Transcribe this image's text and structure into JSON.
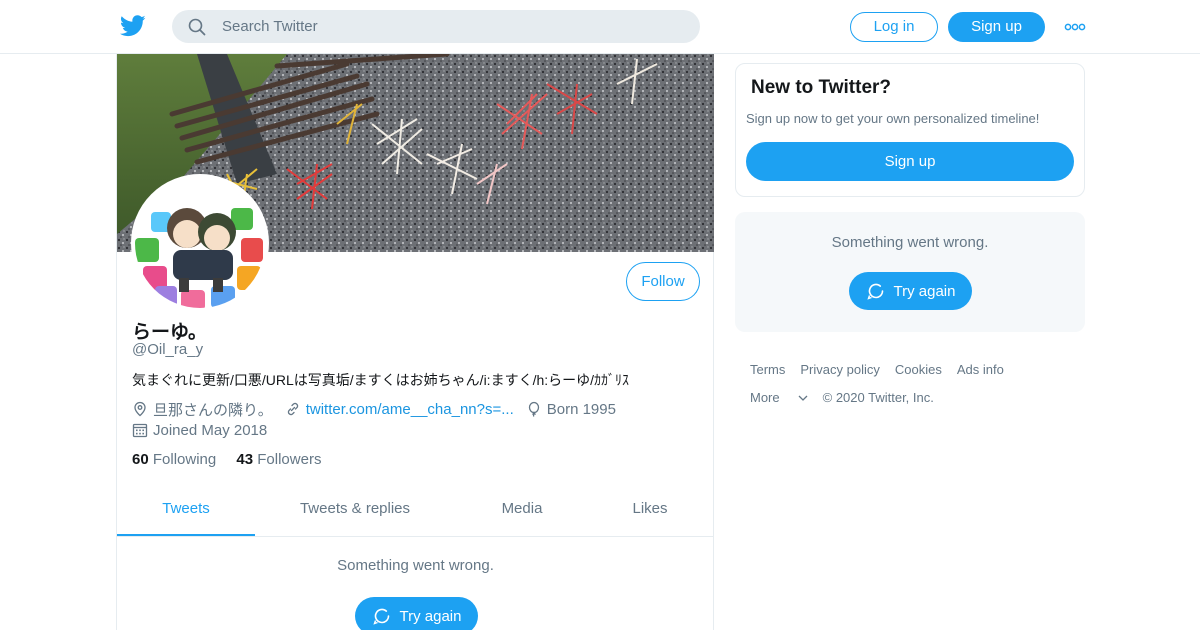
{
  "header": {
    "search_placeholder": "Search Twitter",
    "login_label": "Log in",
    "signup_label": "Sign up"
  },
  "profile": {
    "name": "らーゆ。",
    "handle": "@Oil_ra_y",
    "bio": "気まぐれに更新/口悪/URLは写真垢/ますくはお姉ちゃん/i:ますく/h:らーゆ/ｶｶﾞﾘｽ",
    "location": "旦那さんの隣り。",
    "url": "twitter.com/ame__cha_nn?s=...",
    "born": "Born 1995",
    "joined": "Joined May 2018",
    "following_count": "60",
    "following_label": "Following",
    "followers_count": "43",
    "followers_label": "Followers",
    "follow_label": "Follow"
  },
  "tabs": [
    {
      "label": "Tweets",
      "active": true
    },
    {
      "label": "Tweets & replies",
      "active": false
    },
    {
      "label": "Media",
      "active": false
    },
    {
      "label": "Likes",
      "active": false
    }
  ],
  "timeline": {
    "error_message": "Something went wrong.",
    "retry_label": "Try again"
  },
  "sidebar": {
    "signup_card": {
      "title": "New to Twitter?",
      "text": "Sign up now to get your own personalized timeline!",
      "button": "Sign up"
    },
    "error_card": {
      "message": "Something went wrong.",
      "retry_label": "Try again"
    }
  },
  "footer": {
    "terms": "Terms",
    "privacy": "Privacy policy",
    "cookies": "Cookies",
    "ads": "Ads info",
    "more": "More",
    "copyright": "© 2020 Twitter, Inc."
  },
  "colors": {
    "accent": "#1da1f2",
    "text_primary": "#14171a",
    "text_secondary": "#657786",
    "border": "#e6ecf0",
    "card_background": "#f5f8fa"
  },
  "icons": [
    "twitter-bird-icon",
    "search-icon",
    "more-dots-icon",
    "location-icon",
    "link-icon",
    "balloon-icon",
    "calendar-icon",
    "refresh-icon",
    "chevron-down-icon"
  ]
}
